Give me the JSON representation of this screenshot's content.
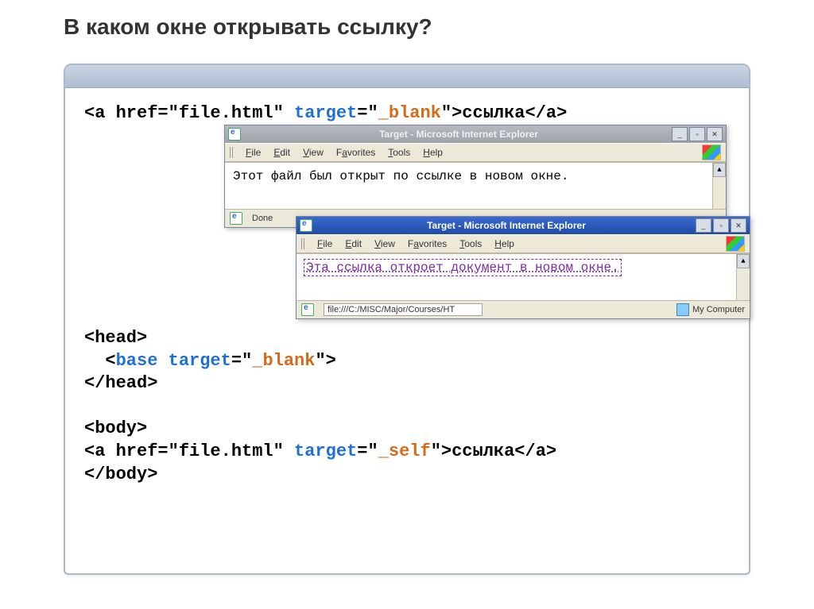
{
  "title": "В каком окне открывать ссылку?",
  "code1_href": "<a href=\"file.html\" ",
  "code1_target_attr": "target",
  "code1_eq": "=\"",
  "code1_target_val": "_blank",
  "code1_rest": "\">ссылка</a>",
  "code2_l1": "<head>",
  "code2_l2a": "  <",
  "code2_l2_base": "base",
  "code2_l2b": " ",
  "code2_l2_target": "target",
  "code2_l2c": "=\"",
  "code2_l2_val": "_blank",
  "code2_l2d": "\">",
  "code2_l3": "</head>",
  "code2_l5": "<body>",
  "code2_l6a": "<a href=\"file.html\" ",
  "code2_l6_target": "target",
  "code2_l6b": "=\"",
  "code2_l6_val": "_self",
  "code2_l6c": "\">ссылка</a>",
  "code2_l7": "</body>",
  "ie1": {
    "title": "Target - Microsoft Internet Explorer",
    "menu": {
      "file": "File",
      "edit": "Edit",
      "view": "View",
      "fav": "Favorites",
      "tools": "Tools",
      "help": "Help"
    },
    "body": "Этот файл был открыт по ссылке в новом окне.",
    "status": "Done"
  },
  "ie2": {
    "title": "Target - Microsoft Internet Explorer",
    "menu": {
      "file": "File",
      "edit": "Edit",
      "view": "View",
      "fav": "Favorites",
      "tools": "Tools",
      "help": "Help"
    },
    "body": "Эта ссылка откроет документ в новом окне.",
    "addr": "file:///C:/MISC/Major/Courses/HT",
    "status_right": "My Computer"
  },
  "winbtns": {
    "min": "_",
    "max": "▫",
    "close": "✕"
  }
}
